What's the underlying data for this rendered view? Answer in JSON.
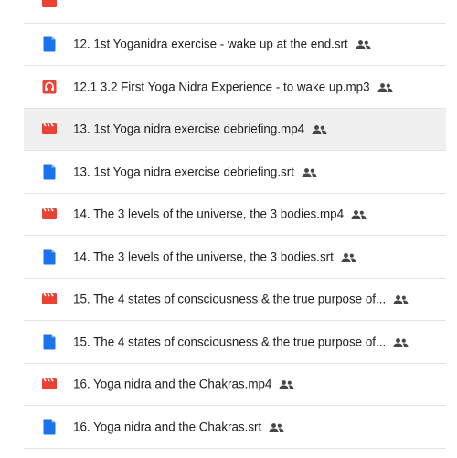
{
  "colors": {
    "doc_blue": "#1a73e8",
    "video_red": "#ea4335",
    "audio_red": "#ea4335",
    "shared_gray": "#444746",
    "selected_bg": "#f0f0f1"
  },
  "files": [
    {
      "name": "",
      "icon": "video-file-icon",
      "shared": false
    },
    {
      "name": "12. 1st Yoganidra exercise - wake up at the end.srt",
      "icon": "document-file-icon",
      "shared": true
    },
    {
      "name": "12.1 3.2 First Yoga Nidra Experience - to wake up.mp3",
      "icon": "audio-file-icon",
      "shared": true
    },
    {
      "name": "13. 1st Yoga nidra exercise debriefing.mp4",
      "icon": "video-file-icon",
      "shared": true
    },
    {
      "name": "13. 1st Yoga nidra exercise debriefing.srt",
      "icon": "document-file-icon",
      "shared": true
    },
    {
      "name": "14. The 3 levels of the universe, the 3 bodies.mp4",
      "icon": "video-file-icon",
      "shared": true
    },
    {
      "name": "14. The 3 levels of the universe, the 3 bodies.srt",
      "icon": "document-file-icon",
      "shared": true
    },
    {
      "name": "15. The 4 states of consciousness & the true purpose of...",
      "icon": "video-file-icon",
      "shared": true
    },
    {
      "name": "15. The 4 states of consciousness & the true purpose of...",
      "icon": "document-file-icon",
      "shared": true
    },
    {
      "name": "16. Yoga nidra and the Chakras.mp4",
      "icon": "video-file-icon",
      "shared": true
    },
    {
      "name": "16. Yoga nidra and the Chakras.srt",
      "icon": "document-file-icon",
      "shared": true
    }
  ],
  "selected_index": 3,
  "shared_icon": "people-shared-icon"
}
